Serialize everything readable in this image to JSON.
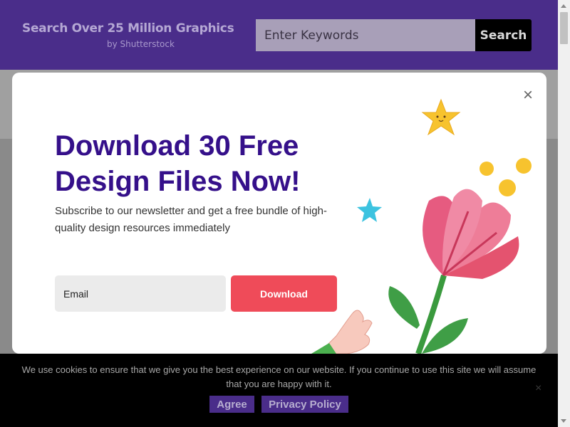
{
  "header": {
    "title": "Search Over 25 Million Graphics",
    "subtitle": "by Shutterstock",
    "search_placeholder": "Enter Keywords",
    "search_button": "Search"
  },
  "modal": {
    "close_glyph": "×",
    "heading": "Download 30 Free Design Files Now!",
    "description": "Subscribe to our newsletter and get a free bundle of high-quality design resources immediately",
    "email_placeholder": "Email",
    "download_button": "Download"
  },
  "cookie_bar": {
    "message": "We use cookies to ensure that we give you the best experience on our website. If you continue to use this site we will assume that you are happy with it.",
    "agree_button": "Agree",
    "privacy_button": "Privacy Policy",
    "close_glyph": "×"
  },
  "colors": {
    "brand_purple": "#4a2d8a",
    "heading_purple": "#35108a",
    "cta_red": "#ef4b59"
  },
  "icons": [
    "close-icon",
    "star-icon",
    "flower-illustration"
  ]
}
